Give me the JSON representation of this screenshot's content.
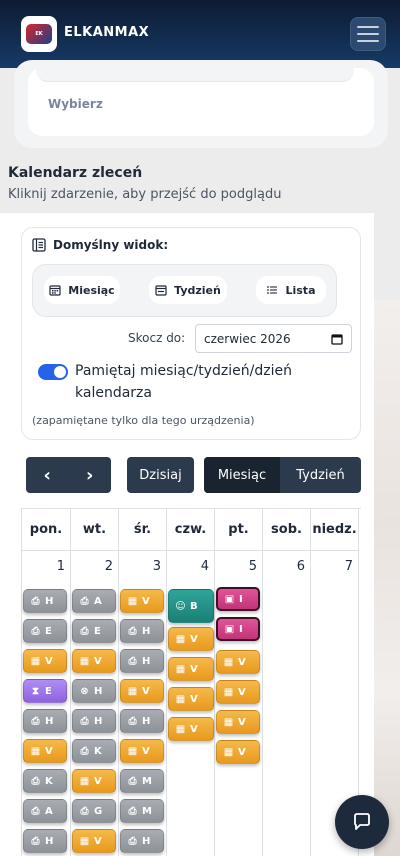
{
  "header": {
    "brand": "ELKANMAX",
    "logo_text": "ELKANMAX",
    "menu_icon": "hamburger-icon"
  },
  "top_card": {
    "select_label": "Wybierz"
  },
  "calendar_section": {
    "title": "Kalendarz zleceń",
    "subtitle": "Kliknij zdarzenie, aby przejść do podglądu"
  },
  "default_view": {
    "title": "Domyślny widok:",
    "options": [
      {
        "label": "Miesiąc",
        "icon": "calendar-month-icon"
      },
      {
        "label": "Tydzień",
        "icon": "calendar-week-icon"
      },
      {
        "label": "Lista",
        "icon": "list-icon"
      }
    ],
    "jump_label": "Skocz do:",
    "jump_value": "czerwiec 2026",
    "remember_label": "Pamiętaj miesiąc/tydzień/dzień kalendarza",
    "remember_enabled": true,
    "remember_note": "(zapamiętane tylko dla tego urządzenia)"
  },
  "toolbar": {
    "prev": "‹",
    "next": "›",
    "today": "Dzisiaj",
    "month": "Miesiąc",
    "week": "Tydzień"
  },
  "days": [
    {
      "name": "pon.",
      "num": "1"
    },
    {
      "name": "wt.",
      "num": "2"
    },
    {
      "name": "śr.",
      "num": "3"
    },
    {
      "name": "czw.",
      "num": "4"
    },
    {
      "name": "pt.",
      "num": "5"
    },
    {
      "name": "sob.",
      "num": "6"
    },
    {
      "name": "niedz.",
      "num": "7"
    }
  ],
  "colors": {
    "gray": "#9a9ea5",
    "orange": "#efa92e",
    "purple": "#9f75e8",
    "teal": "#25928a",
    "pink": "#d1438a",
    "accent": "#2563eb",
    "header": "#0d1b33"
  },
  "events": [
    {
      "day": 0,
      "row": 0,
      "color": "gray",
      "icon": "⎙",
      "text": "H"
    },
    {
      "day": 0,
      "row": 1,
      "color": "gray",
      "icon": "⎙",
      "text": "E"
    },
    {
      "day": 0,
      "row": 2,
      "color": "orange",
      "icon": "▦",
      "text": "V"
    },
    {
      "day": 0,
      "row": 3,
      "color": "purple",
      "icon": "⧗",
      "text": "E"
    },
    {
      "day": 0,
      "row": 4,
      "color": "gray",
      "icon": "⎙",
      "text": "H"
    },
    {
      "day": 0,
      "row": 5,
      "color": "orange",
      "icon": "▦",
      "text": "V"
    },
    {
      "day": 0,
      "row": 6,
      "color": "gray",
      "icon": "⎙",
      "text": "K"
    },
    {
      "day": 0,
      "row": 7,
      "color": "gray",
      "icon": "⎙",
      "text": "A"
    },
    {
      "day": 0,
      "row": 8,
      "color": "gray",
      "icon": "⎙",
      "text": "H"
    },
    {
      "day": 1,
      "row": 0,
      "color": "gray",
      "icon": "⎙",
      "text": "A"
    },
    {
      "day": 1,
      "row": 1,
      "color": "gray",
      "icon": "⎙",
      "text": "E"
    },
    {
      "day": 1,
      "row": 2,
      "color": "orange",
      "icon": "▦",
      "text": "V"
    },
    {
      "day": 1,
      "row": 3,
      "color": "gray",
      "icon": "⊗",
      "text": "H"
    },
    {
      "day": 1,
      "row": 4,
      "color": "gray",
      "icon": "⎙",
      "text": "H"
    },
    {
      "day": 1,
      "row": 5,
      "color": "gray",
      "icon": "⎙",
      "text": "K"
    },
    {
      "day": 1,
      "row": 6,
      "color": "orange",
      "icon": "▦",
      "text": "V"
    },
    {
      "day": 1,
      "row": 7,
      "color": "gray",
      "icon": "⎙",
      "text": "G"
    },
    {
      "day": 1,
      "row": 8,
      "color": "orange",
      "icon": "▦",
      "text": "V"
    },
    {
      "day": 2,
      "row": 0,
      "color": "orange",
      "icon": "▦",
      "text": "V"
    },
    {
      "day": 2,
      "row": 1,
      "color": "gray",
      "icon": "⎙",
      "text": "H"
    },
    {
      "day": 2,
      "row": 2,
      "color": "gray",
      "icon": "⎙",
      "text": "H"
    },
    {
      "day": 2,
      "row": 3,
      "color": "orange",
      "icon": "▦",
      "text": "V"
    },
    {
      "day": 2,
      "row": 4,
      "color": "gray",
      "icon": "⎙",
      "text": "H"
    },
    {
      "day": 2,
      "row": 5,
      "color": "orange",
      "icon": "▦",
      "text": "V"
    },
    {
      "day": 2,
      "row": 6,
      "color": "gray",
      "icon": "⎙",
      "text": "M"
    },
    {
      "day": 2,
      "row": 7,
      "color": "gray",
      "icon": "⎙",
      "text": "M"
    },
    {
      "day": 2,
      "row": 8,
      "color": "gray",
      "icon": "⎙",
      "text": "H"
    },
    {
      "day": 3,
      "row": 0,
      "color": "teal",
      "icon": "☺",
      "text": "B"
    },
    {
      "day": 3,
      "row": 1,
      "color": "orange",
      "icon": "▦",
      "text": "V"
    },
    {
      "day": 3,
      "row": 2,
      "color": "orange",
      "icon": "▦",
      "text": "V"
    },
    {
      "day": 3,
      "row": 3,
      "color": "orange",
      "icon": "▦",
      "text": "V"
    },
    {
      "day": 3,
      "row": 4,
      "color": "orange",
      "icon": "▦",
      "text": "V"
    },
    {
      "day": 4,
      "row": 0,
      "color": "pink",
      "icon": "▣",
      "text": "I"
    },
    {
      "day": 4,
      "row": 1,
      "color": "pink",
      "icon": "▣",
      "text": "I"
    },
    {
      "day": 4,
      "row": 2,
      "color": "orange",
      "icon": "▦",
      "text": "V"
    },
    {
      "day": 4,
      "row": 3,
      "color": "orange",
      "icon": "▦",
      "text": "V"
    },
    {
      "day": 4,
      "row": 4,
      "color": "orange",
      "icon": "▦",
      "text": "V"
    },
    {
      "day": 4,
      "row": 5,
      "color": "orange",
      "icon": "▦",
      "text": "V"
    }
  ]
}
